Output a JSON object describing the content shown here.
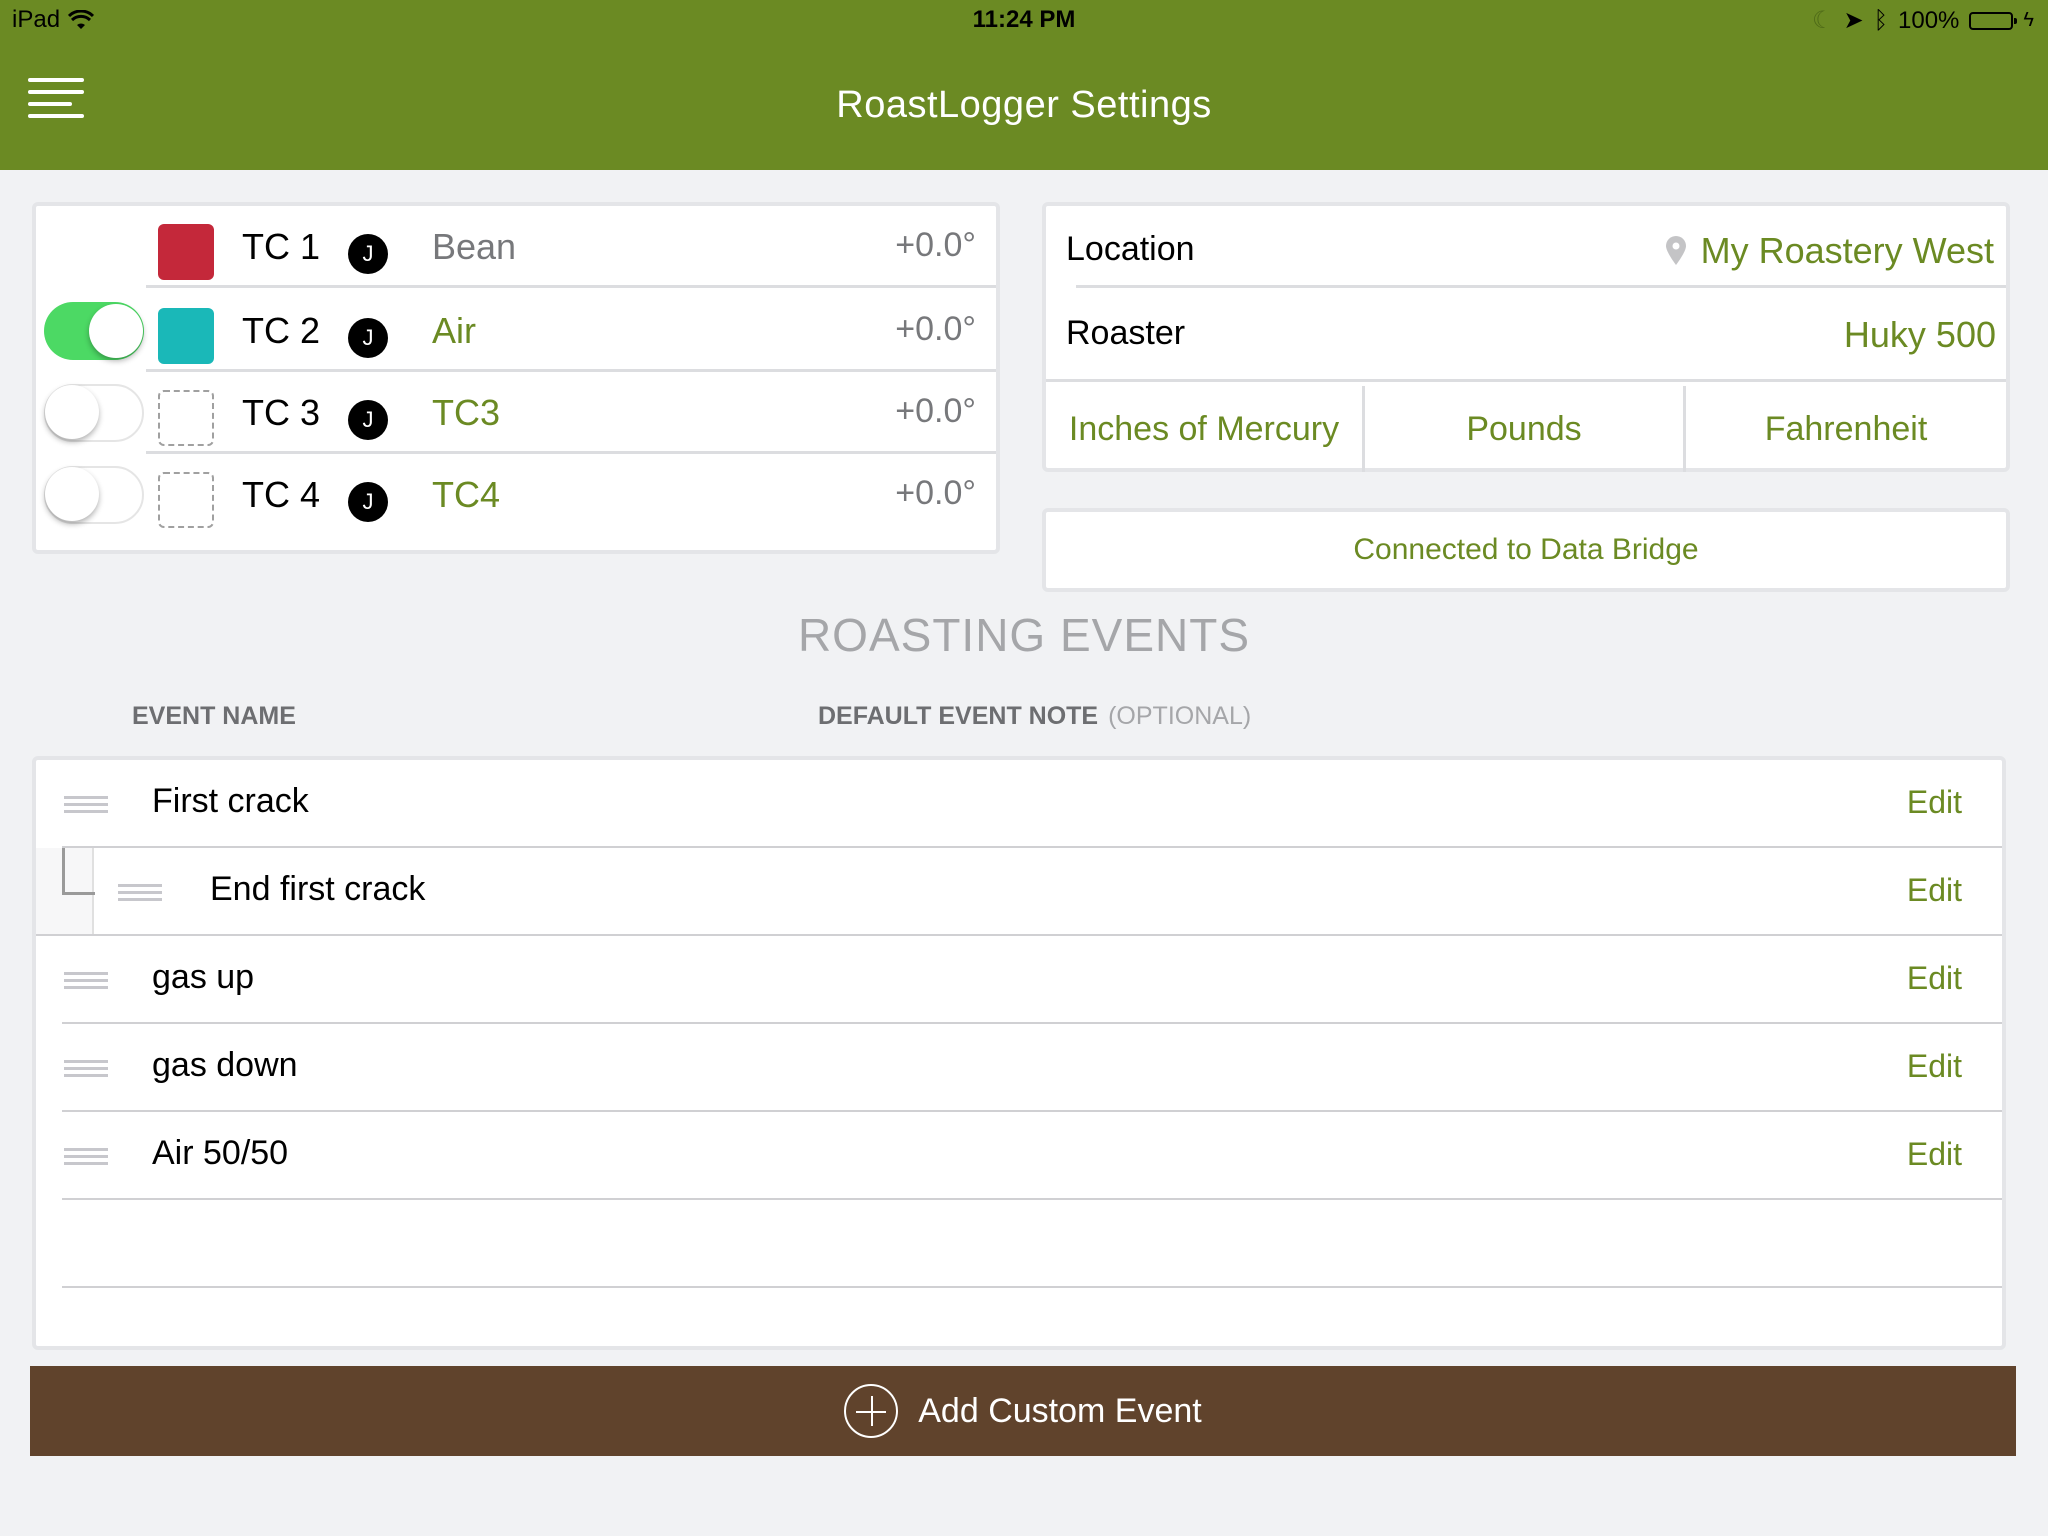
{
  "status_bar": {
    "carrier": "iPad",
    "time": "11:24 PM",
    "battery": "100%"
  },
  "header": {
    "title": "RoastLogger Settings",
    "menu_icon": "hamburger-menu-icon"
  },
  "thermocouples": [
    {
      "label": "TC 1",
      "type": "J",
      "name": "Bean",
      "offset": "+0.0°",
      "color": "#c4283a",
      "enabled": null,
      "name_style": "gray"
    },
    {
      "label": "TC 2",
      "type": "J",
      "name": "Air",
      "offset": "+0.0°",
      "color": "#1ab8b8",
      "enabled": true,
      "name_style": "green"
    },
    {
      "label": "TC 3",
      "type": "J",
      "name": "TC3",
      "offset": "+0.0°",
      "color": null,
      "enabled": false,
      "name_style": "green"
    },
    {
      "label": "TC 4",
      "type": "J",
      "name": "TC4",
      "offset": "+0.0°",
      "color": null,
      "enabled": false,
      "name_style": "green"
    }
  ],
  "settings": {
    "location_label": "Location",
    "location_value": "My Roastery West",
    "roaster_label": "Roaster",
    "roaster_value": "Huky 500",
    "units": [
      "Inches of Mercury",
      "Pounds",
      "Fahrenheit"
    ],
    "connection_status": "Connected to Data Bridge"
  },
  "events": {
    "heading": "ROASTING EVENTS",
    "col_name": "EVENT NAME",
    "col_note": "DEFAULT EVENT NOTE",
    "col_note_optional": "(OPTIONAL)",
    "edit_label": "Edit",
    "items": [
      {
        "name": "First crack",
        "child": false
      },
      {
        "name": "End first crack",
        "child": true
      },
      {
        "name": "gas up",
        "child": false
      },
      {
        "name": "gas down",
        "child": false
      },
      {
        "name": "Air 50/50",
        "child": false
      }
    ],
    "add_label": "Add Custom Event"
  },
  "colors": {
    "brand_green": "#6b8a23",
    "button_brown": "#60432c",
    "toggle_on": "#4cd964"
  }
}
